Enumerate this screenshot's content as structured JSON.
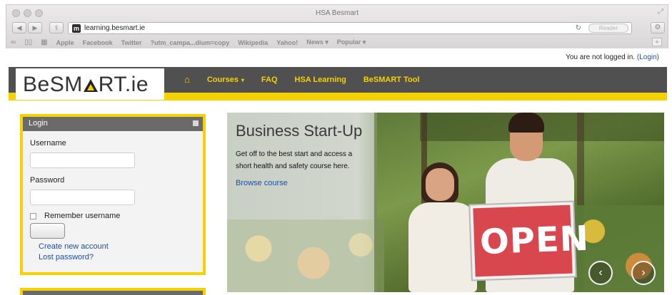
{
  "browser": {
    "window_title": "HSA Besmart",
    "url": "learning.besmart.ie",
    "favicon_letter": "m",
    "reader_label": "Reader",
    "bookmarks": [
      "Apple",
      "Facebook",
      "Twitter",
      "?utm_campa...dium=copy",
      "Wikipedia",
      "Yahoo!",
      "News ▾",
      "Popular ▾"
    ],
    "icons": {
      "back": "back-icon",
      "forward": "forward-icon",
      "share": "share-icon",
      "reload": "reload-icon",
      "settings": "gear-icon",
      "reading_list": "reading-list-icon",
      "bookmarks_book": "bookmarks-icon",
      "top_sites": "grid-icon",
      "add": "plus-icon"
    }
  },
  "header": {
    "login_status_text": "You are not logged in. ",
    "login_link": "(Login)",
    "logo_text_left": "BeSM",
    "logo_text_right": "RT.ie",
    "nav": {
      "courses": "Courses",
      "faq": "FAQ",
      "hsa_learning": "HSA Learning",
      "besmart_tool": "BeSMART Tool"
    }
  },
  "login_block": {
    "title": "Login",
    "username_label": "Username",
    "username_value": "",
    "password_label": "Password",
    "password_value": "",
    "remember_label": "Remember username",
    "remember_checked": false,
    "login_button_label": "",
    "create_account": "Create new account",
    "lost_password": "Lost password?"
  },
  "slider": {
    "title": "Business Start-Up",
    "body": "Get off to the best start and access a short health and safety course here.",
    "link": "Browse course",
    "sign_text": "OPEN",
    "prev_icon": "chevron-left-icon",
    "next_icon": "chevron-right-icon"
  },
  "colors": {
    "accent_yellow": "#f5d100",
    "navbar_grey": "#505050",
    "link_blue": "#1a4fa6",
    "sign_red": "#d9474e"
  }
}
